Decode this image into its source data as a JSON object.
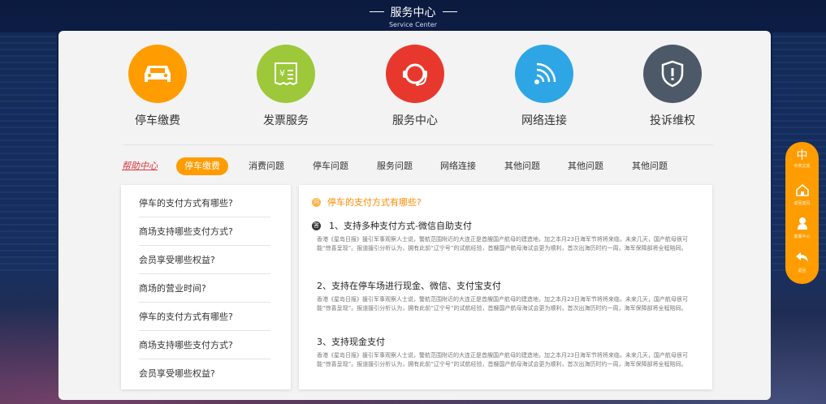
{
  "header": {
    "title": "服务中心",
    "subtitle": "Service Center"
  },
  "services": [
    {
      "label": "停车缴费",
      "icon": "car-icon",
      "color": "#ff9c00"
    },
    {
      "label": "发票服务",
      "icon": "invoice-icon",
      "color": "#9cc83a"
    },
    {
      "label": "服务中心",
      "icon": "headset-icon",
      "color": "#e8382d"
    },
    {
      "label": "网络连接",
      "icon": "wifi-icon",
      "color": "#2ea6e6"
    },
    {
      "label": "投诉维权",
      "icon": "shield-icon",
      "color": "#4d5868"
    }
  ],
  "tabs": {
    "help": "帮助中心",
    "items": [
      "停车缴费",
      "消费问题",
      "停车问题",
      "服务问题",
      "网络连接",
      "其他问题",
      "其他问题",
      "其他问题"
    ],
    "active_index": 0
  },
  "faq_list": [
    "停车的支付方式有哪些?",
    "商场支持哪些支付方式?",
    "会员享受哪些权益?",
    "商场的营业时间?",
    "停车的支付方式有哪些?",
    "商场支持哪些支付方式?",
    "会员享受哪些权益?"
  ],
  "content": {
    "question_icon": "问",
    "question": "停车的支付方式有哪些?",
    "answer_icon": "答",
    "answers": [
      {
        "title": "1、支持多种支付方式-微信自助支付",
        "body": "香港《星岛日报》援引军事观察人士说，警航范围附近的大连正是首艘国产航母的建造地，加之本月23日海军节将将来临，未来几天，国产航母很可能“惊喜呈现”。报道援引分析认为，拥有此前“辽宁号”的试航经验，首艘国产航母海试会更为顺利，首次出海历时约一周，海军保障部将全程陪同。"
      },
      {
        "title": "2、支持在停车场进行现金、微信、支付宝支付",
        "body": "香港《星岛日报》援引军事观察人士说，警航范围附近的大连正是首艘国产航母的建造地，加之本月23日海军节将将来临，未来几天，国产航母很可能“惊喜呈现”。报道援引分析认为，拥有此前“辽宁号”的试航经验，首艘国产航母海试会更为顺利，首次出海历时约一周，海军保障部将全程陪同。"
      },
      {
        "title": "3、支持现金支付",
        "body": "香港《星岛日报》援引军事观察人士说，警航范围附近的大连正是首艘国产航母的建造地，加之本月23日海军节将将来临，未来几天，国产航母很可能“惊喜呈现”。报道援引分析认为，拥有此前“辽宁号”的试航经验，首艘国产航母海试会更为顺利，首次出海历时约一周，海军保障部将全程陪同。"
      }
    ]
  },
  "sidebar": [
    {
      "icon": "中",
      "label": "中英文版"
    },
    {
      "icon": "home-icon",
      "label": "返回首页"
    },
    {
      "icon": "service-person-icon",
      "label": "客服中心"
    },
    {
      "icon": "back-arrow-icon",
      "label": "返回"
    }
  ]
}
